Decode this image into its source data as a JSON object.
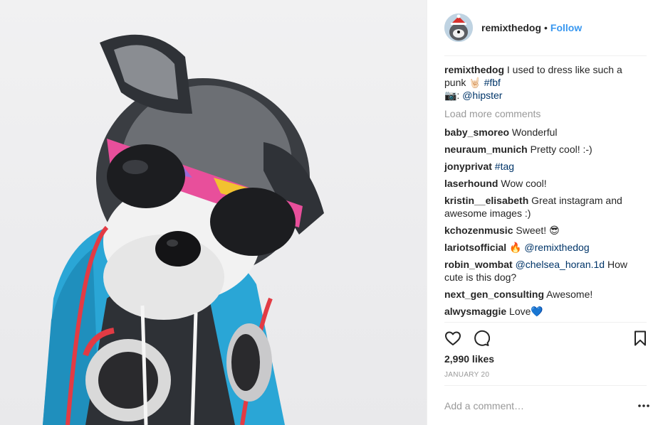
{
  "post": {
    "photo_alt": "schnauzer dog wearing sunglasses and headphones",
    "username": "remixthedog",
    "separator": "•",
    "follow_label": "Follow"
  },
  "caption": {
    "user": "remixthedog",
    "text": " I used to dress like such a punk 🤘🏻 ",
    "hashtag": "#fbf",
    "line2_prefix": "📷: ",
    "mention": "@hipster"
  },
  "load_more_label": "Load more comments",
  "comments": [
    {
      "user": "baby_smoreo",
      "text": " Wonderful"
    },
    {
      "user": "neuraum_munich",
      "text": " Pretty cool! :-)"
    },
    {
      "user": "jonyprivat",
      "text": " ",
      "tag": "#tag"
    },
    {
      "user": "laserhound",
      "text": " Wow cool!"
    },
    {
      "user": "kristin__elisabeth",
      "text": " Great instagram and awesome images :)"
    },
    {
      "user": "kchozenmusic",
      "text": " Sweet! 😎"
    },
    {
      "user": "lariotsofficial",
      "text": " 🔥 ",
      "tag": "@remixthedog"
    },
    {
      "user": "robin_wombat",
      "text": " ",
      "tag": "@chelsea_horan.1d",
      "after": " How cute is this dog?"
    },
    {
      "user": "next_gen_consulting",
      "text": " Awesome!"
    },
    {
      "user": "alwysmaggie",
      "text": " Love💙"
    }
  ],
  "actions": {
    "like_icon": "heart-icon",
    "comment_icon": "comment-icon",
    "save_icon": "bookmark-icon"
  },
  "likes": "2,990 likes",
  "date": "JANUARY 20",
  "add_comment_placeholder": "Add a comment…",
  "more_icon": "more-options-icon",
  "colors": {
    "link": "#3897f0",
    "tag": "#003569",
    "muted": "#999999",
    "text": "#262626"
  }
}
